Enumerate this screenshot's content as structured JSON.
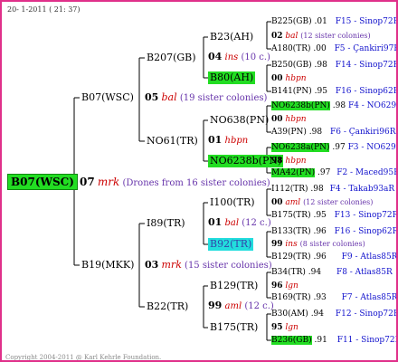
{
  "header_date": "20- 1-2011 ( 21: 37)",
  "footer": "Copyright 2004-2011 @ Karl Kehrle Foundation.",
  "root": {
    "label": "B07(WSC)"
  },
  "root_year": {
    "code": "07",
    "mark": "mrk",
    "note": "(Drones from 16 sister colonies)"
  },
  "upper": {
    "label": "B07(WSC)",
    "year": {
      "code": "05",
      "mark": "bal",
      "note": "(19 sister colonies)"
    },
    "b207": {
      "label": "B207(GB)",
      "year": {
        "code": "04",
        "mark": "ins",
        "note": "(10 c.)"
      }
    },
    "b23": {
      "label": "B23(AH)"
    },
    "b80": {
      "label": "B80(AH)"
    },
    "no61": {
      "label": "NO61(TR)",
      "year": {
        "code": "01",
        "mark": "hbpn"
      }
    },
    "no638": {
      "label": "NO638(PN)"
    },
    "no6238b": {
      "label": "NO6238b(PN)"
    }
  },
  "lower": {
    "label": "B19(MKK)",
    "year": {
      "code": "03",
      "mark": "mrk",
      "note": "(15 sister colonies)"
    },
    "i89": {
      "label": "I89(TR)",
      "year": {
        "code": "01",
        "mark": "bal",
        "note": "(12 c.)"
      }
    },
    "i100": {
      "label": "I100(TR)"
    },
    "b92": {
      "label": "B92(TR)"
    },
    "b22": {
      "label": "B22(TR)",
      "year": {
        "code": "99",
        "mark": "aml",
        "note": "(12 c.)"
      }
    },
    "b129": {
      "label": "B129(TR)"
    },
    "b175": {
      "label": "B175(TR)"
    }
  },
  "right": {
    "r1": {
      "name": "B225(GB)",
      "val": ".01",
      "src": "F15 - Sinop72R"
    },
    "r2": {
      "code": "02",
      "mark": "bal",
      "note": "(12 sister colonies)"
    },
    "r3": {
      "name": "A180(TR)",
      "val": ".00",
      "src": "F5 - Çankiri97R"
    },
    "r4": {
      "name": "B250(GB)",
      "val": ".98",
      "src": "F14 - Sinop72R"
    },
    "r5": {
      "code": "00",
      "mark": "hbpn"
    },
    "r6": {
      "name": "B141(PN)",
      "val": ".95",
      "src": "F16 - Sinop62R"
    },
    "r7": {
      "name": "NO6238b(PN)",
      "val": ".98",
      "src": "F4 - NO6294R"
    },
    "r8": {
      "code": "00",
      "mark": "hbpn"
    },
    "r9": {
      "name": "A39(PN)",
      "val": ".98",
      "src": "F6 - Çankiri96R"
    },
    "r10": {
      "name": "NO6238a(PN)",
      "val": ".97",
      "src": "F3 - NO6294R"
    },
    "r11": {
      "code": "98",
      "mark": "hbpn"
    },
    "r12": {
      "name": "MA42(PN)",
      "val": ".97",
      "src": "F2 - Maced95R"
    },
    "r13": {
      "name": "I112(TR)",
      "val": ".98",
      "src": "F4 - Takab93aR"
    },
    "r14": {
      "code": "00",
      "mark": "aml",
      "note": "(12 sister colonies)"
    },
    "r15": {
      "name": "B175(TR)",
      "val": ".95",
      "src": "F13 - Sinop72R"
    },
    "r16": {
      "name": "B133(TR)",
      "val": ".96",
      "src": "F16 - Sinop62R"
    },
    "r17": {
      "code": "99",
      "mark": "ins",
      "note": "(8 sister colonies)"
    },
    "r18": {
      "name": "B129(TR)",
      "val": ".96",
      "src": "F9 - Atlas85R"
    },
    "r19": {
      "name": "B34(TR)",
      "val": ".94",
      "src": "F8 - Atlas85R"
    },
    "r20": {
      "code": "96",
      "mark": "lgn"
    },
    "r21": {
      "name": "B169(TR)",
      "val": ".93",
      "src": "F7 - Atlas85R"
    },
    "r22": {
      "name": "B30(AM)",
      "val": ".94",
      "src": "F12 - Sinop72R"
    },
    "r23": {
      "code": "95",
      "mark": "lgn"
    },
    "r24": {
      "name": "B236(GB)",
      "val": ".91",
      "src": "F11 - Sinop72R"
    }
  },
  "colors": {
    "border": "#e0308a",
    "green": "#22dd22",
    "cyan": "#22dddd",
    "mark": "#cc0000",
    "note": "#6633aa",
    "source": "#1111cc"
  }
}
